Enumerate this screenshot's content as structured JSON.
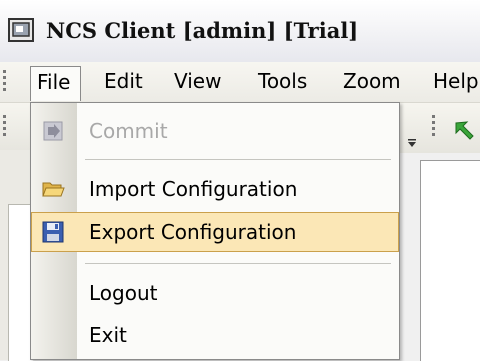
{
  "window": {
    "title": "NCS Client [admin] [Trial]"
  },
  "menubar": {
    "items": [
      {
        "label": "File"
      },
      {
        "label": "Edit"
      },
      {
        "label": "View"
      },
      {
        "label": "Tools"
      },
      {
        "label": "Zoom"
      },
      {
        "label": "Help"
      }
    ]
  },
  "file_menu": {
    "items": [
      {
        "label": "Commit",
        "icon": "commit-icon",
        "enabled": false
      },
      {
        "label": "Import Configuration",
        "icon": "folder-open-icon",
        "enabled": true
      },
      {
        "label": "Export Configuration",
        "icon": "floppy-disk-icon",
        "enabled": true,
        "highlighted": true
      },
      {
        "label": "Logout",
        "enabled": true
      },
      {
        "label": "Exit",
        "enabled": true
      }
    ]
  },
  "colors": {
    "highlight": "#fbe7b6",
    "highlight_border": "#caa04c",
    "toolbar_arrow": "#3aa53a"
  }
}
